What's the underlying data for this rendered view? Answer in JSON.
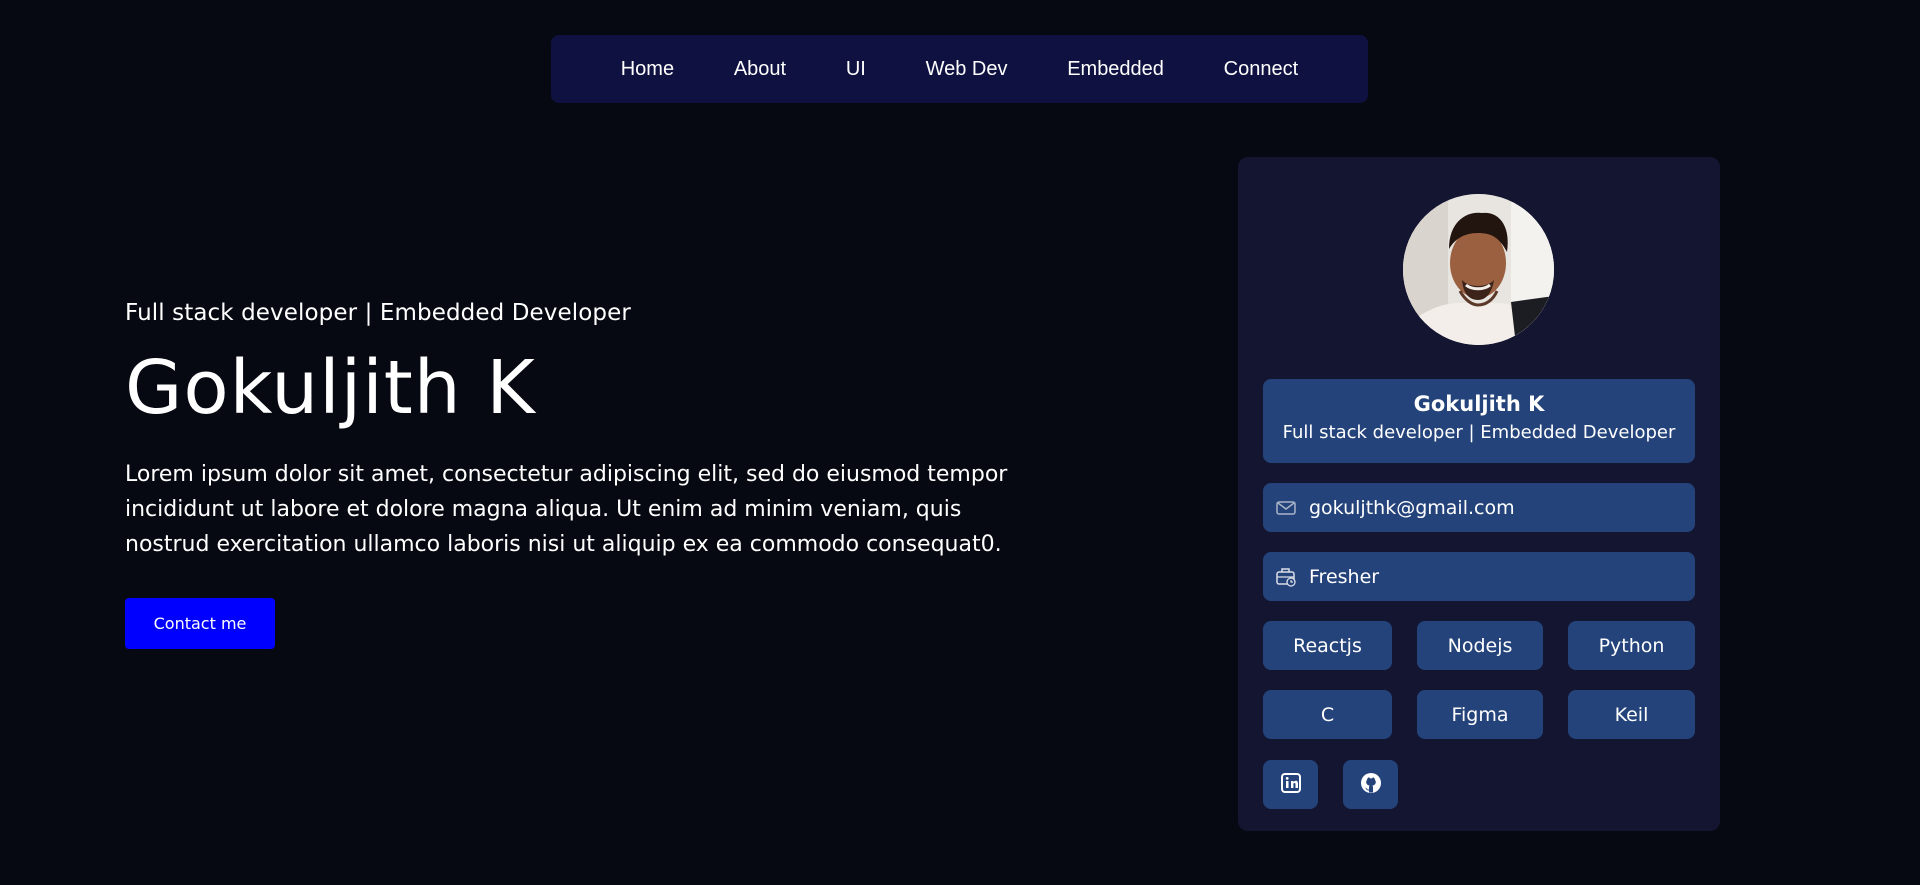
{
  "nav": {
    "items": [
      "Home",
      "About",
      "UI",
      "Web Dev",
      "Embedded",
      "Connect"
    ]
  },
  "hero": {
    "subtitle": "Full stack developer | Embedded Developer",
    "name": "Gokuljith K",
    "description": "Lorem ipsum dolor sit amet, consectetur adipiscing elit, sed do eiusmod tempor incididunt ut labore et dolore magna aliqua. Ut enim ad minim veniam, quis nostrud exercitation ullamco laboris nisi ut aliquip ex ea commodo consequat0.",
    "contact_label": "Contact me"
  },
  "profile_card": {
    "name": "Gokuljith K",
    "role": "Full stack developer | Embedded Developer",
    "email": "gokuljthk@gmail.com",
    "status": "Fresher",
    "skills": [
      "Reactjs",
      "Nodejs",
      "Python",
      "C",
      "Figma",
      "Keil"
    ],
    "social_icons": [
      "linkedin-icon",
      "github-icon"
    ]
  },
  "colors": {
    "background": "#070912",
    "nav_background": "#0f1240",
    "card_background": "#131531",
    "chip_background": "#24437a",
    "button": "#0000ff"
  }
}
